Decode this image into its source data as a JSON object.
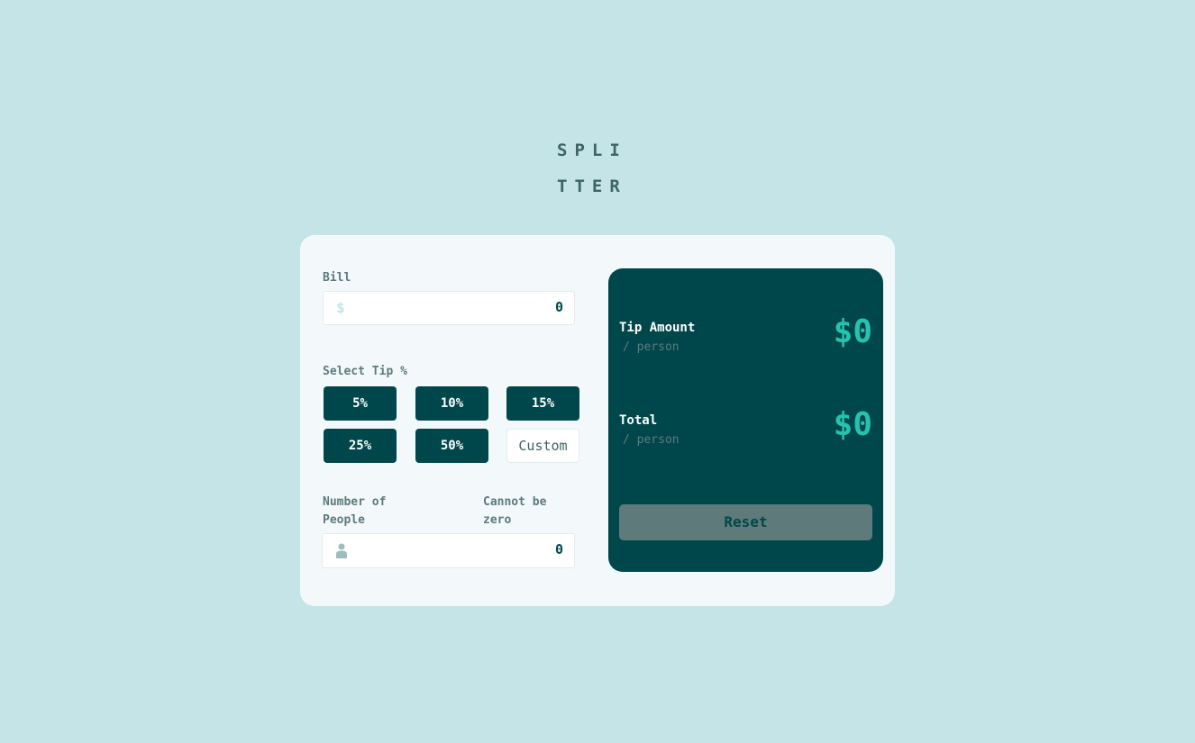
{
  "logo": {
    "line1": "SPLI",
    "line2": "TTER"
  },
  "bill": {
    "label": "Bill",
    "currency_icon": "dollar-icon",
    "currency_symbol": "$",
    "value": "0"
  },
  "tip": {
    "label": "Select Tip %",
    "options": [
      "5%",
      "10%",
      "15%",
      "25%",
      "50%"
    ],
    "custom_placeholder": "Custom"
  },
  "people": {
    "label": "Number of People",
    "error": "Cannot be zero",
    "icon": "person-icon",
    "value": "0"
  },
  "results": {
    "tip_label": "Tip Amount",
    "tip_sub": "/ person",
    "tip_value": "$0",
    "total_label": "Total",
    "total_sub": "/ person",
    "total_value": "$0",
    "reset_label": "Reset"
  },
  "colors": {
    "background": "#c5e4e7",
    "card": "#f3f9fa",
    "dark_cyan": "#00474b",
    "accent": "#26c2ae",
    "reset_disabled": "#5f7a7a"
  }
}
